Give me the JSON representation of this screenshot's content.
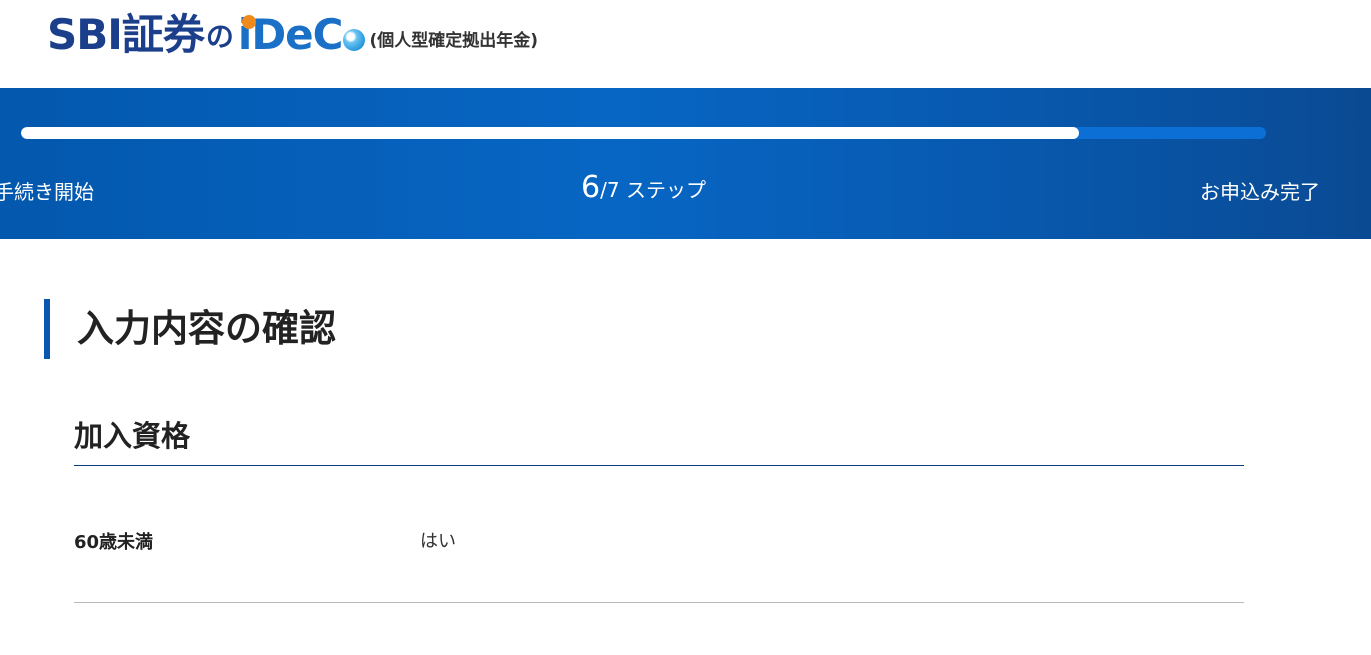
{
  "header": {
    "logo": {
      "brand": "SBI証券",
      "connector": "の",
      "product_i": "i",
      "product_rest": "DeC",
      "subtitle": "(個人型確定拠出年金)"
    }
  },
  "progress": {
    "start_label": "手続き開始",
    "current_step": "6",
    "total_label": "/7 ステップ",
    "end_label": "お申込み完了",
    "fill_fraction": 0.85,
    "colors": {
      "fill": "#ffffff",
      "track": "#0b6fd6",
      "band": "#0766c4"
    }
  },
  "main": {
    "title": "入力内容の確認",
    "accent_color": "#0b57b0",
    "sections": [
      {
        "heading": "加入資格",
        "rows": [
          {
            "label": "60歳未満",
            "value": "はい"
          }
        ]
      }
    ]
  }
}
